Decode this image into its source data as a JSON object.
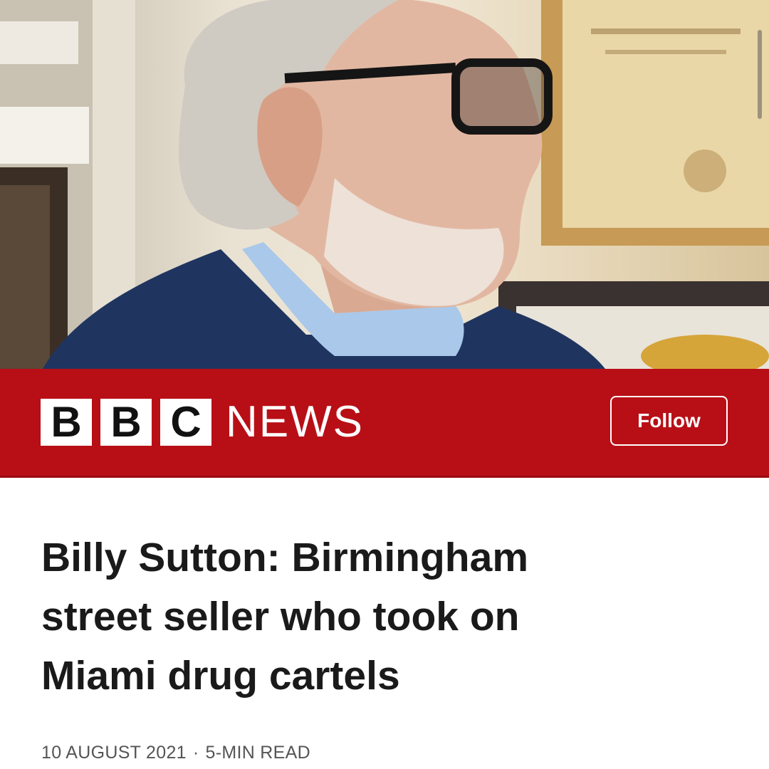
{
  "hero": {
    "image_description_icon": "portrait-photo",
    "colors": {
      "jacket": "#1f3560",
      "scarf": "#a9c8ea",
      "hair": "#cfcac2",
      "skin": "#e2b7a1"
    }
  },
  "brand": {
    "logo_letters": [
      "B",
      "B",
      "C"
    ],
    "logo_word": "NEWS",
    "bar_color": "#b80f17"
  },
  "follow_button": {
    "label": "Follow"
  },
  "article": {
    "headline_lines": [
      "Billy Sutton: Birmingham",
      "street seller who took on",
      "Miami drug cartels"
    ],
    "date": "10 AUGUST 2021",
    "separator": "·",
    "read_time": "5-MIN READ"
  }
}
